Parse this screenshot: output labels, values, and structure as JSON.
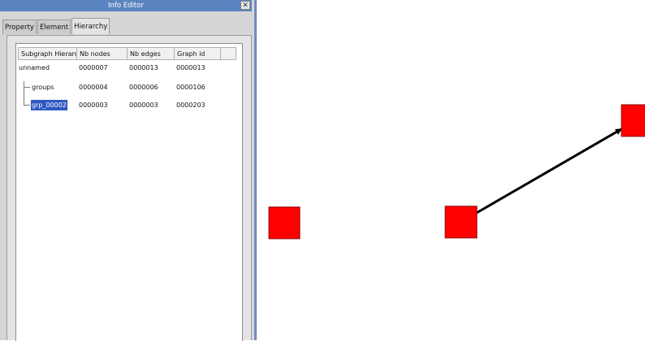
{
  "window": {
    "title": "Info Editor",
    "close_glyph": "✕"
  },
  "tabs": [
    {
      "label": "Property",
      "active": false
    },
    {
      "label": "Element",
      "active": false
    },
    {
      "label": "Hierarchy",
      "active": true
    }
  ],
  "hierarchy": {
    "columns": [
      "Subgraph Hierarchy",
      "Nb nodes",
      "Nb edges",
      "Graph id"
    ],
    "rows": [
      {
        "name": "unnamed",
        "nodes": "0000007",
        "edges": "0000013",
        "id": "0000013"
      },
      {
        "name": "groups",
        "nodes": "0000004",
        "edges": "0000006",
        "id": "0000106"
      },
      {
        "name": "grp_00002",
        "nodes": "0000003",
        "edges": "0000003",
        "id": "0000203",
        "selected": true
      }
    ]
  },
  "graph": {
    "node_color": "#ff0000",
    "node_border": "#8b0000",
    "edge_color": "#000000"
  }
}
